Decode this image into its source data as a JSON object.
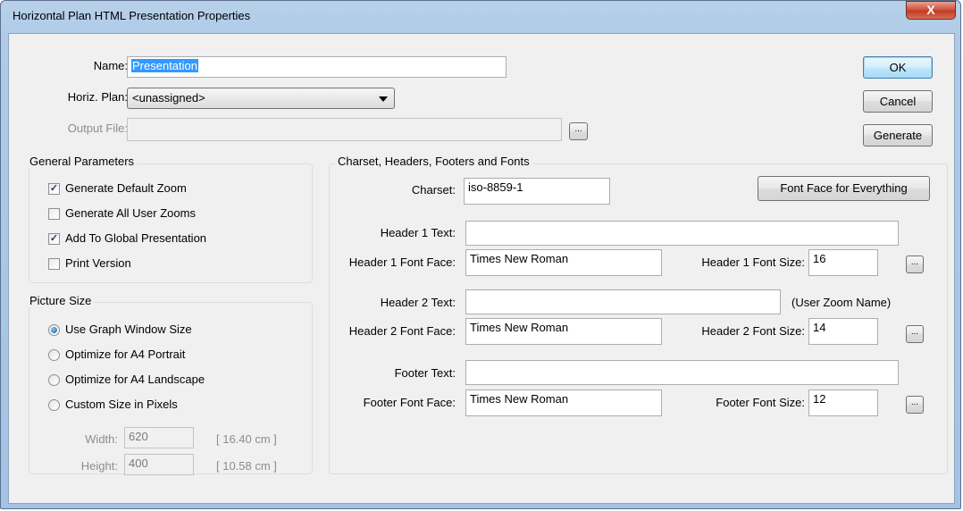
{
  "window": {
    "title": "Horizontal Plan HTML Presentation Properties",
    "close_glyph": "X"
  },
  "top": {
    "name_label": "Name:",
    "name_value": "Presentation",
    "horiz_plan_label": "Horiz. Plan:",
    "horiz_plan_value": "<unassigned>",
    "output_file_label": "Output File:",
    "output_file_value": "",
    "browse_label": "..."
  },
  "buttons": {
    "ok": "OK",
    "cancel": "Cancel",
    "generate": "Generate"
  },
  "general": {
    "title": "General Parameters",
    "items": [
      {
        "label": "Generate Default Zoom",
        "checked": true
      },
      {
        "label": "Generate All User Zooms",
        "checked": false
      },
      {
        "label": "Add To Global Presentation",
        "checked": true
      },
      {
        "label": "Print Version",
        "checked": false
      }
    ]
  },
  "picture": {
    "title": "Picture Size",
    "options": [
      {
        "label": "Use Graph Window Size",
        "selected": true
      },
      {
        "label": "Optimize for A4 Portrait",
        "selected": false
      },
      {
        "label": "Optimize for A4 Landscape",
        "selected": false
      },
      {
        "label": "Custom Size in Pixels",
        "selected": false
      }
    ],
    "width_label": "Width:",
    "width_value": "620",
    "width_cm": "[ 16.40 cm ]",
    "height_label": "Height:",
    "height_value": "400",
    "height_cm": "[ 10.58 cm ]"
  },
  "charset": {
    "title": "Charset, Headers, Footers and Fonts",
    "charset_label": "Charset:",
    "charset_value": "iso-8859-1",
    "font_face_all": "Font Face for Everything",
    "header1_text_label": "Header 1 Text:",
    "header1_text_value": "",
    "header1_face_label": "Header 1 Font Face:",
    "header1_face_value": "Times New Roman",
    "header1_size_label": "Header 1 Font Size:",
    "header1_size_value": "16",
    "header2_text_label": "Header 2 Text:",
    "header2_text_value": "",
    "header2_hint": "(User Zoom Name)",
    "header2_face_label": "Header 2 Font Face:",
    "header2_face_value": "Times New Roman",
    "header2_size_label": "Header 2 Font Size:",
    "header2_size_value": "14",
    "footer_text_label": "Footer Text:",
    "footer_text_value": "",
    "footer_face_label": "Footer Font Face:",
    "footer_face_value": "Times New Roman",
    "footer_size_label": "Footer Font Size:",
    "footer_size_value": "12",
    "ellipsis": "..."
  }
}
